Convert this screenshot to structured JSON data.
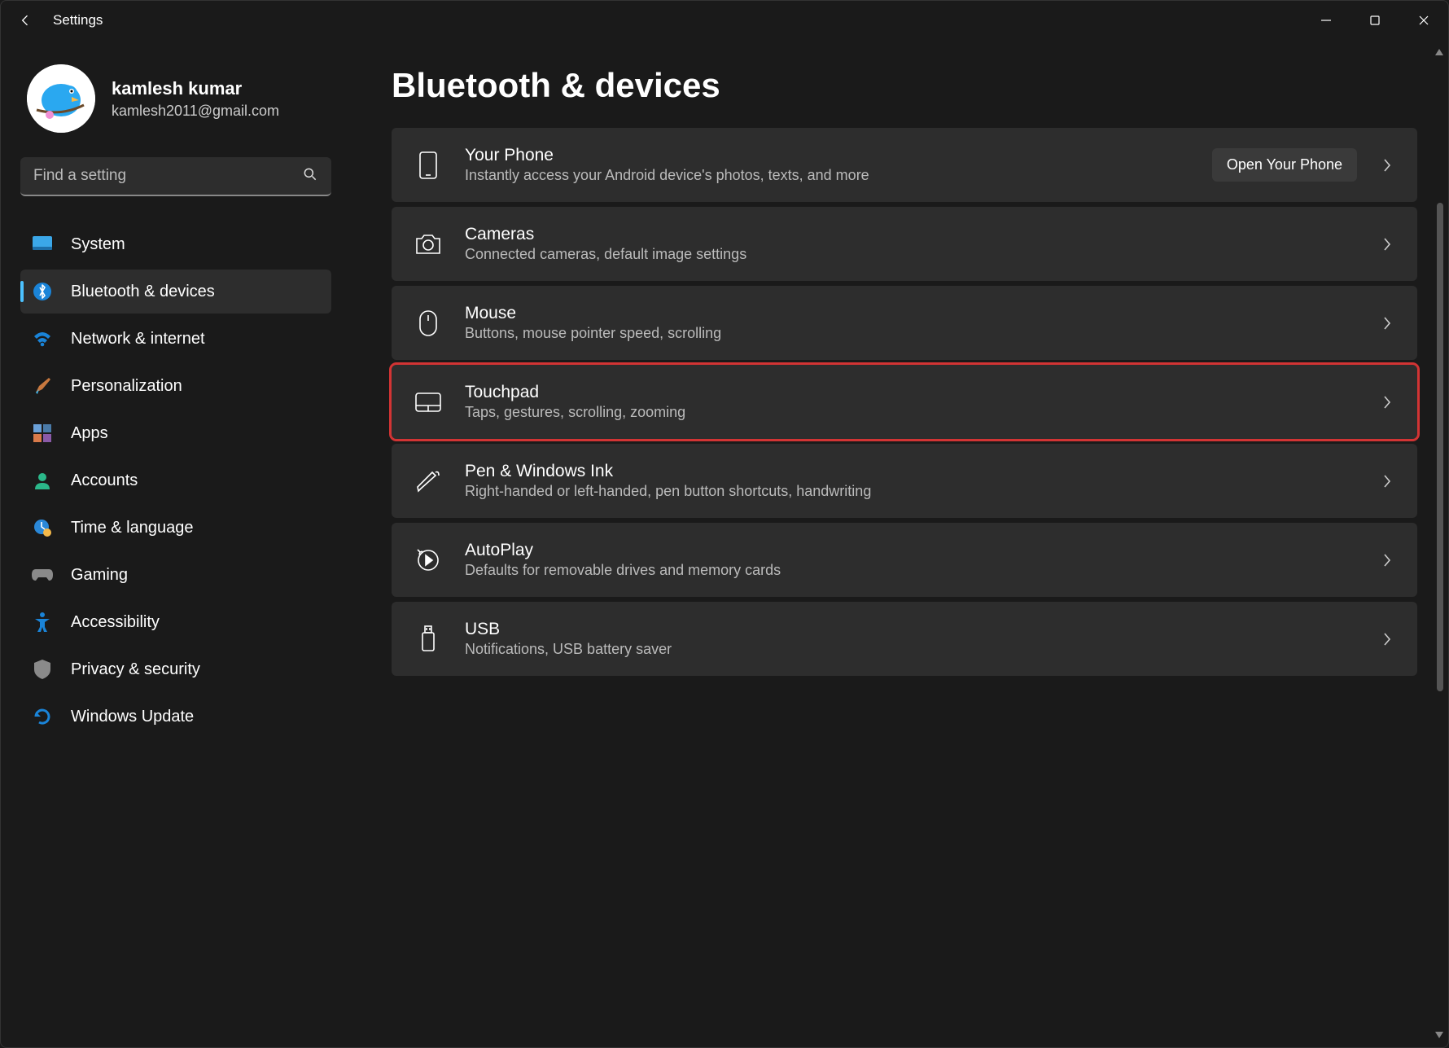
{
  "app_title": "Settings",
  "user": {
    "name": "kamlesh kumar",
    "email": "kamlesh2011@gmail.com"
  },
  "search": {
    "placeholder": "Find a setting"
  },
  "nav": [
    {
      "label": "System"
    },
    {
      "label": "Bluetooth & devices"
    },
    {
      "label": "Network & internet"
    },
    {
      "label": "Personalization"
    },
    {
      "label": "Apps"
    },
    {
      "label": "Accounts"
    },
    {
      "label": "Time & language"
    },
    {
      "label": "Gaming"
    },
    {
      "label": "Accessibility"
    },
    {
      "label": "Privacy & security"
    },
    {
      "label": "Windows Update"
    }
  ],
  "page_title": "Bluetooth & devices",
  "cards": {
    "yourphone": {
      "title": "Your Phone",
      "sub": "Instantly access your Android device's photos, texts, and more",
      "button": "Open Your Phone"
    },
    "cameras": {
      "title": "Cameras",
      "sub": "Connected cameras, default image settings"
    },
    "mouse": {
      "title": "Mouse",
      "sub": "Buttons, mouse pointer speed, scrolling"
    },
    "touchpad": {
      "title": "Touchpad",
      "sub": "Taps, gestures, scrolling, zooming"
    },
    "pen": {
      "title": "Pen & Windows Ink",
      "sub": "Right-handed or left-handed, pen button shortcuts, handwriting"
    },
    "autoplay": {
      "title": "AutoPlay",
      "sub": "Defaults for removable drives and memory cards"
    },
    "usb": {
      "title": "USB",
      "sub": "Notifications, USB battery saver"
    }
  }
}
